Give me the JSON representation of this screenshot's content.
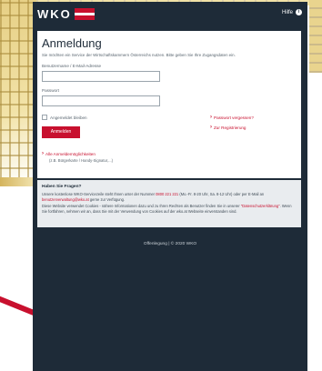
{
  "header": {
    "logo_text": "WKO",
    "help_label": "Hilfe",
    "help_icon": "i"
  },
  "login": {
    "title": "Anmeldung",
    "subtitle": "Sie möchten ein Service der Wirtschaftskammern Österreichs nutzen. Bitte geben Sie Ihre Zugangsdaten ein.",
    "username_label": "Benutzername / E-Mail-Adresse",
    "username_value": "",
    "password_label": "Passwort",
    "password_value": "",
    "remember_label": "Angemeldet bleiben",
    "submit_label": "Anmelden",
    "forgot_password": "Passwort vergessen?",
    "register": "Zur Registrierung",
    "all_options": "Alle Anmeldemöglichkeiten",
    "all_options_hint": "(z.B. Bürgerkarte / Handy-Signatur,...)"
  },
  "info": {
    "heading": "Haben Sie Fragen?",
    "contact_pre": "Unsere kostenlose WKO-Servicezeile steht Ihnen unter der Nummer ",
    "phone": "0800 221 221",
    "contact_mid": " (Mo.-Fr. 8-20 Uhr, Sa. 8-12 Uhr) oder per E-Mail an ",
    "email": "benutzerverwaltung@wko.at",
    "contact_post": " gerne zur Verfügung.",
    "cookie_pre": "Diese Website verwendet Cookies - nähere Informationen dazu und zu Ihren Rechten als Benutzer finden Sie in unserer ",
    "privacy_link": "\"Datenschutzerklärung\"",
    "cookie_post": ". Wenn Sie fortfahren, nehmen wir an, dass Sie mit der Verwendung von Cookies auf der wko.at Webseite einverstanden sind."
  },
  "footer": {
    "text": "Offenlegung | © 2020 WKO"
  },
  "colors": {
    "brand_red": "#c8102e",
    "panel_dark": "#1e2b38"
  }
}
